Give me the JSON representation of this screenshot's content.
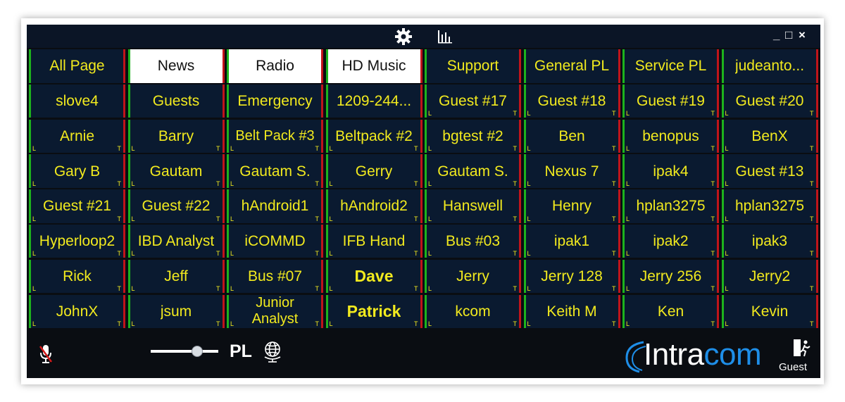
{
  "titlebar": {
    "gear_icon": "gear-icon",
    "stats_icon": "bar-chart-icon",
    "minimize": "_",
    "maximize": "□",
    "close": "×"
  },
  "keys": [
    {
      "label": "All Page",
      "style": "tab"
    },
    {
      "label": "News",
      "style": "white"
    },
    {
      "label": "Radio",
      "style": "white"
    },
    {
      "label": "HD Music",
      "style": "white"
    },
    {
      "label": "Support",
      "style": "tab"
    },
    {
      "label": "General PL",
      "style": "tab"
    },
    {
      "label": "Service PL",
      "style": "tab"
    },
    {
      "label": "judeanto...",
      "style": "tab"
    },
    {
      "label": "slove4",
      "style": "key"
    },
    {
      "label": "Guests",
      "style": "key"
    },
    {
      "label": "Emergency",
      "style": "key"
    },
    {
      "label": "1209-244...",
      "style": "key"
    },
    {
      "label": "Guest #17",
      "style": "key",
      "marks": true
    },
    {
      "label": "Guest #18",
      "style": "key",
      "marks": true
    },
    {
      "label": "Guest #19",
      "style": "key",
      "marks": true
    },
    {
      "label": "Guest #20",
      "style": "key",
      "marks": true
    },
    {
      "label": "Arnie",
      "style": "key",
      "marks": true
    },
    {
      "label": "Barry",
      "style": "key",
      "marks": true
    },
    {
      "label": "Belt Pack #3",
      "style": "multi",
      "marks": true
    },
    {
      "label": "Beltpack #2",
      "style": "key",
      "marks": true
    },
    {
      "label": "bgtest #2",
      "style": "key",
      "marks": true
    },
    {
      "label": "Ben",
      "style": "key",
      "marks": true
    },
    {
      "label": "benopus",
      "style": "key",
      "marks": true
    },
    {
      "label": "BenX",
      "style": "key",
      "marks": true
    },
    {
      "label": "Gary B",
      "style": "key",
      "marks": true
    },
    {
      "label": "Gautam",
      "style": "key",
      "marks": true
    },
    {
      "label": "Gautam S.",
      "style": "key",
      "marks": true
    },
    {
      "label": "Gerry",
      "style": "key",
      "marks": true
    },
    {
      "label": "Gautam S.",
      "style": "key",
      "marks": true
    },
    {
      "label": "Nexus 7",
      "style": "key",
      "marks": true
    },
    {
      "label": "ipak4",
      "style": "key",
      "marks": true
    },
    {
      "label": "Guest #13",
      "style": "key",
      "marks": true
    },
    {
      "label": "Guest #21",
      "style": "key",
      "marks": true
    },
    {
      "label": "Guest #22",
      "style": "key",
      "marks": true
    },
    {
      "label": "hAndroid1",
      "style": "key",
      "marks": true
    },
    {
      "label": "hAndroid2",
      "style": "key",
      "marks": true
    },
    {
      "label": "Hanswell",
      "style": "key",
      "marks": true
    },
    {
      "label": "Henry",
      "style": "key",
      "marks": true
    },
    {
      "label": "hplan3275",
      "style": "key",
      "marks": true
    },
    {
      "label": "hplan3275",
      "style": "key",
      "marks": true
    },
    {
      "label": "Hyperloop2",
      "style": "key",
      "marks": true
    },
    {
      "label": "IBD Analyst",
      "style": "key",
      "marks": true
    },
    {
      "label": "iCOMMD",
      "style": "key",
      "marks": true
    },
    {
      "label": "IFB Hand",
      "style": "key",
      "marks": true
    },
    {
      "label": "Bus #03",
      "style": "key",
      "marks": true
    },
    {
      "label": "ipak1",
      "style": "key",
      "marks": true
    },
    {
      "label": "ipak2",
      "style": "key",
      "marks": true
    },
    {
      "label": "ipak3",
      "style": "key",
      "marks": true
    },
    {
      "label": "Rick",
      "style": "key",
      "marks": true
    },
    {
      "label": "Jeff",
      "style": "key",
      "marks": true
    },
    {
      "label": "Bus #07",
      "style": "key",
      "marks": true
    },
    {
      "label": "Dave",
      "style": "bold",
      "marks": true
    },
    {
      "label": "Jerry",
      "style": "key",
      "marks": true
    },
    {
      "label": "Jerry 128",
      "style": "key",
      "marks": true
    },
    {
      "label": "Jerry 256",
      "style": "key",
      "marks": true
    },
    {
      "label": "Jerry2",
      "style": "key",
      "marks": true
    },
    {
      "label": "JohnX",
      "style": "key",
      "marks": true
    },
    {
      "label": "jsum",
      "style": "key",
      "marks": true
    },
    {
      "label": "Junior Analyst",
      "style": "multi",
      "marks": true
    },
    {
      "label": "Patrick",
      "style": "bold",
      "marks": true
    },
    {
      "label": "kcom",
      "style": "key",
      "marks": true
    },
    {
      "label": "Keith M",
      "style": "key",
      "marks": true
    },
    {
      "label": "Ken",
      "style": "key",
      "marks": true
    },
    {
      "label": "Kevin",
      "style": "key",
      "marks": true
    }
  ],
  "key_marks": {
    "listen": "L",
    "talk": "T"
  },
  "bottombar": {
    "mic_icon": "mic-muted-icon",
    "volume_level": 0.72,
    "pl_label": "PL",
    "globe_icon": "globe-icon",
    "logo_text": "Intracom",
    "exit_icon": "exit-icon",
    "user_label": "Guest"
  },
  "colors": {
    "key_bg": "#0a1a30",
    "key_text": "#f2ea1e",
    "listen_bar": "#1db31d",
    "talk_bar": "#c0141a",
    "logo_blue": "#1e8ee8"
  }
}
